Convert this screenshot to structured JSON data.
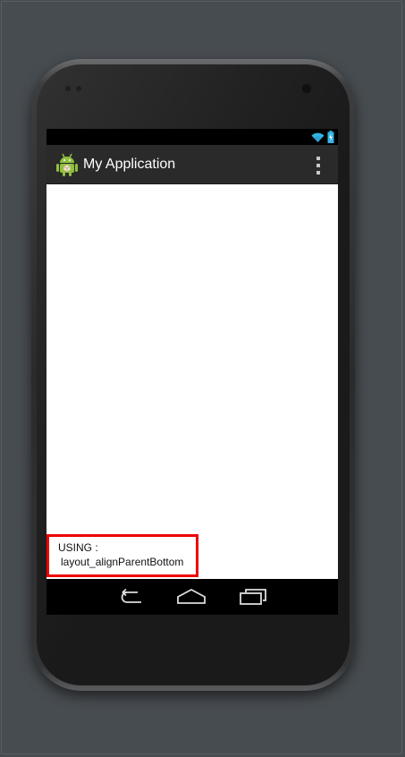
{
  "app": {
    "title": "My Application",
    "icon": "android-robot-icon"
  },
  "status_bar": {
    "icons": [
      "wifi-icon",
      "battery-icon"
    ]
  },
  "action_bar": {
    "overflow_icon": "overflow-menu-icon"
  },
  "content": {
    "bottom_text_line1": "USING :",
    "bottom_text_line2": "layout_alignParentBottom",
    "highlight_color": "#ee0000"
  },
  "nav_bar": {
    "buttons": [
      "back-icon",
      "home-icon",
      "recent-apps-icon"
    ]
  },
  "colors": {
    "desktop_background": "#474c50",
    "action_bar": "#2a2a2a",
    "wifi": "#33b5e5"
  }
}
